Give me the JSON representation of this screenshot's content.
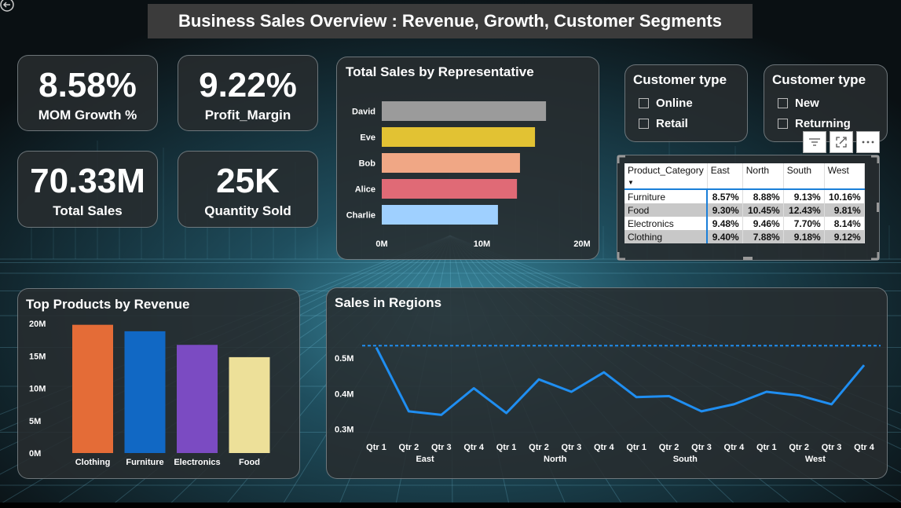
{
  "dashboard": {
    "title": "Business Sales Overview : Revenue, Growth, Customer Segments"
  },
  "kpis": [
    {
      "value": "8.58%",
      "label": "MOM Growth %"
    },
    {
      "value": "9.22%",
      "label": "Profit_Margin"
    },
    {
      "value": "70.33M",
      "label": "Total Sales"
    },
    {
      "value": "25K",
      "label": "Quantity Sold"
    }
  ],
  "slicers": [
    {
      "title": "Customer type",
      "options": [
        "Online",
        "Retail"
      ]
    },
    {
      "title": "Customer type",
      "options": [
        "New",
        "Returning"
      ]
    }
  ],
  "visual_header_icons": [
    "filter-icon",
    "focus-mode-icon",
    "more-options-icon"
  ],
  "matrix": {
    "columns": [
      "Product_Category",
      "East",
      "North",
      "South",
      "West"
    ],
    "rows": [
      {
        "category": "Furniture",
        "values": [
          "8.57%",
          "8.88%",
          "9.13%",
          "10.16%"
        ]
      },
      {
        "category": "Food",
        "values": [
          "9.30%",
          "10.45%",
          "12.43%",
          "9.81%"
        ]
      },
      {
        "category": "Electronics",
        "values": [
          "9.48%",
          "9.46%",
          "7.70%",
          "8.14%"
        ]
      },
      {
        "category": "Clothing",
        "values": [
          "9.40%",
          "7.88%",
          "9.18%",
          "9.12%"
        ]
      }
    ]
  },
  "colors": {
    "panel_bg": "#2a2e31",
    "title_bg": "#3b3b3b",
    "line": "#1f8ef1",
    "matrix_accent": "#1a7fd8"
  },
  "chart_data": [
    {
      "type": "bar",
      "orientation": "horizontal",
      "title": "Total Sales by Representative",
      "categories": [
        "David",
        "Eve",
        "Bob",
        "Alice",
        "Charlie"
      ],
      "values": [
        16.4,
        15.3,
        13.8,
        13.5,
        11.6
      ],
      "colors": [
        "#9b9b9b",
        "#e2c233",
        "#f0a785",
        "#e06a76",
        "#9fd0ff"
      ],
      "xticks": [
        "0M",
        "10M",
        "20M"
      ],
      "xlim": [
        0,
        20
      ],
      "unit": "M"
    },
    {
      "type": "bar",
      "title": "Top Products by Revenue",
      "categories": [
        "Clothing",
        "Furniture",
        "Electronics",
        "Food"
      ],
      "values": [
        19.8,
        18.8,
        16.7,
        14.8
      ],
      "colors": [
        "#e46c37",
        "#1168c4",
        "#7b4bc2",
        "#ede099"
      ],
      "yticks": [
        "0M",
        "5M",
        "10M",
        "15M",
        "20M"
      ],
      "ylim": [
        0,
        20
      ],
      "unit": "M"
    },
    {
      "type": "line",
      "title": "Sales in Regions",
      "regions": [
        "East",
        "North",
        "South",
        "West"
      ],
      "quarters": [
        "Qtr 1",
        "Qtr 2",
        "Qtr 3",
        "Qtr 4"
      ],
      "values": [
        0.53,
        0.35,
        0.34,
        0.415,
        0.345,
        0.44,
        0.405,
        0.46,
        0.39,
        0.393,
        0.35,
        0.37,
        0.405,
        0.395,
        0.37,
        0.48
      ],
      "yticks": [
        "0.3M",
        "0.4M",
        "0.5M"
      ],
      "ylim": [
        0.29,
        0.56
      ],
      "reference_line": 0.535,
      "unit": "M"
    }
  ]
}
